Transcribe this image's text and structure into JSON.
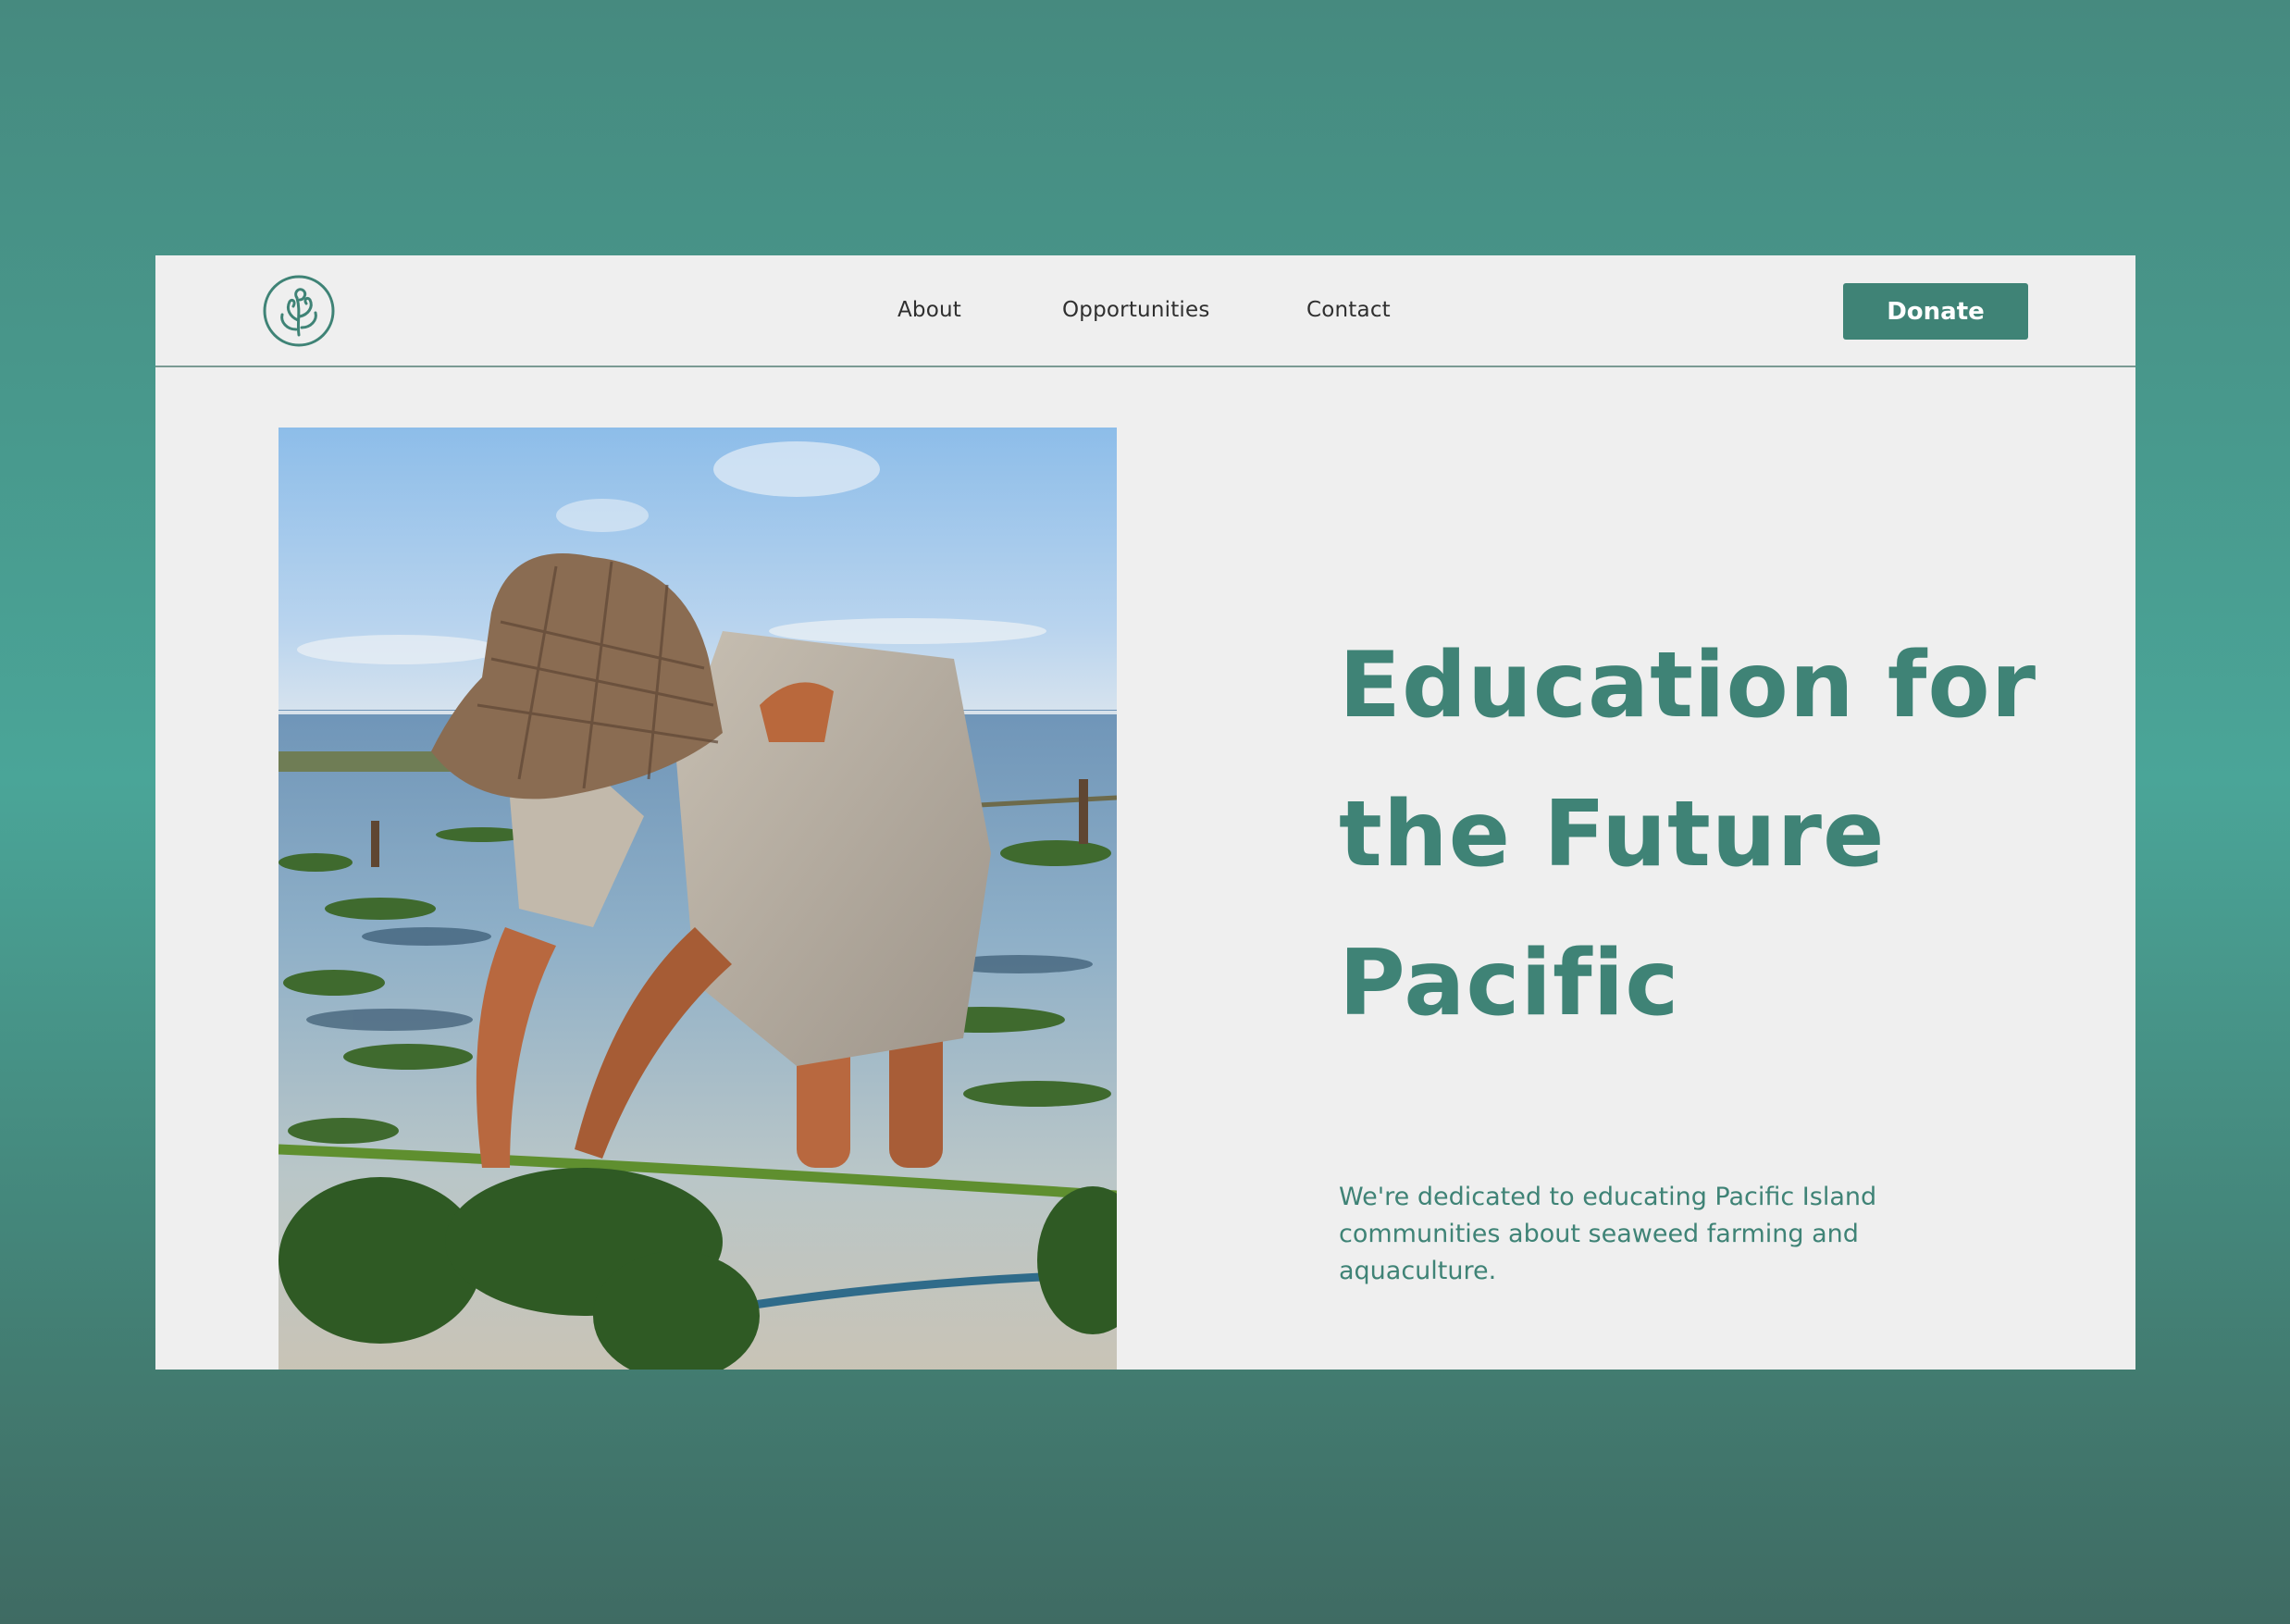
{
  "brand": {
    "logo_icon": "seaweed-emblem-icon",
    "accent_color": "#3f8376",
    "background_color": "#efefef"
  },
  "nav": {
    "items": [
      {
        "label": "About"
      },
      {
        "label": "Opportunities"
      },
      {
        "label": "Contact"
      }
    ],
    "donate_label": "Donate"
  },
  "hero": {
    "title_lines": [
      "Education for",
      "the Future",
      "Pacific"
    ],
    "description": "We're dedicated to educating Pacific Island communities about seaweed farming and aquaculture.",
    "image_subject": "seaweed-farmer-photo"
  }
}
